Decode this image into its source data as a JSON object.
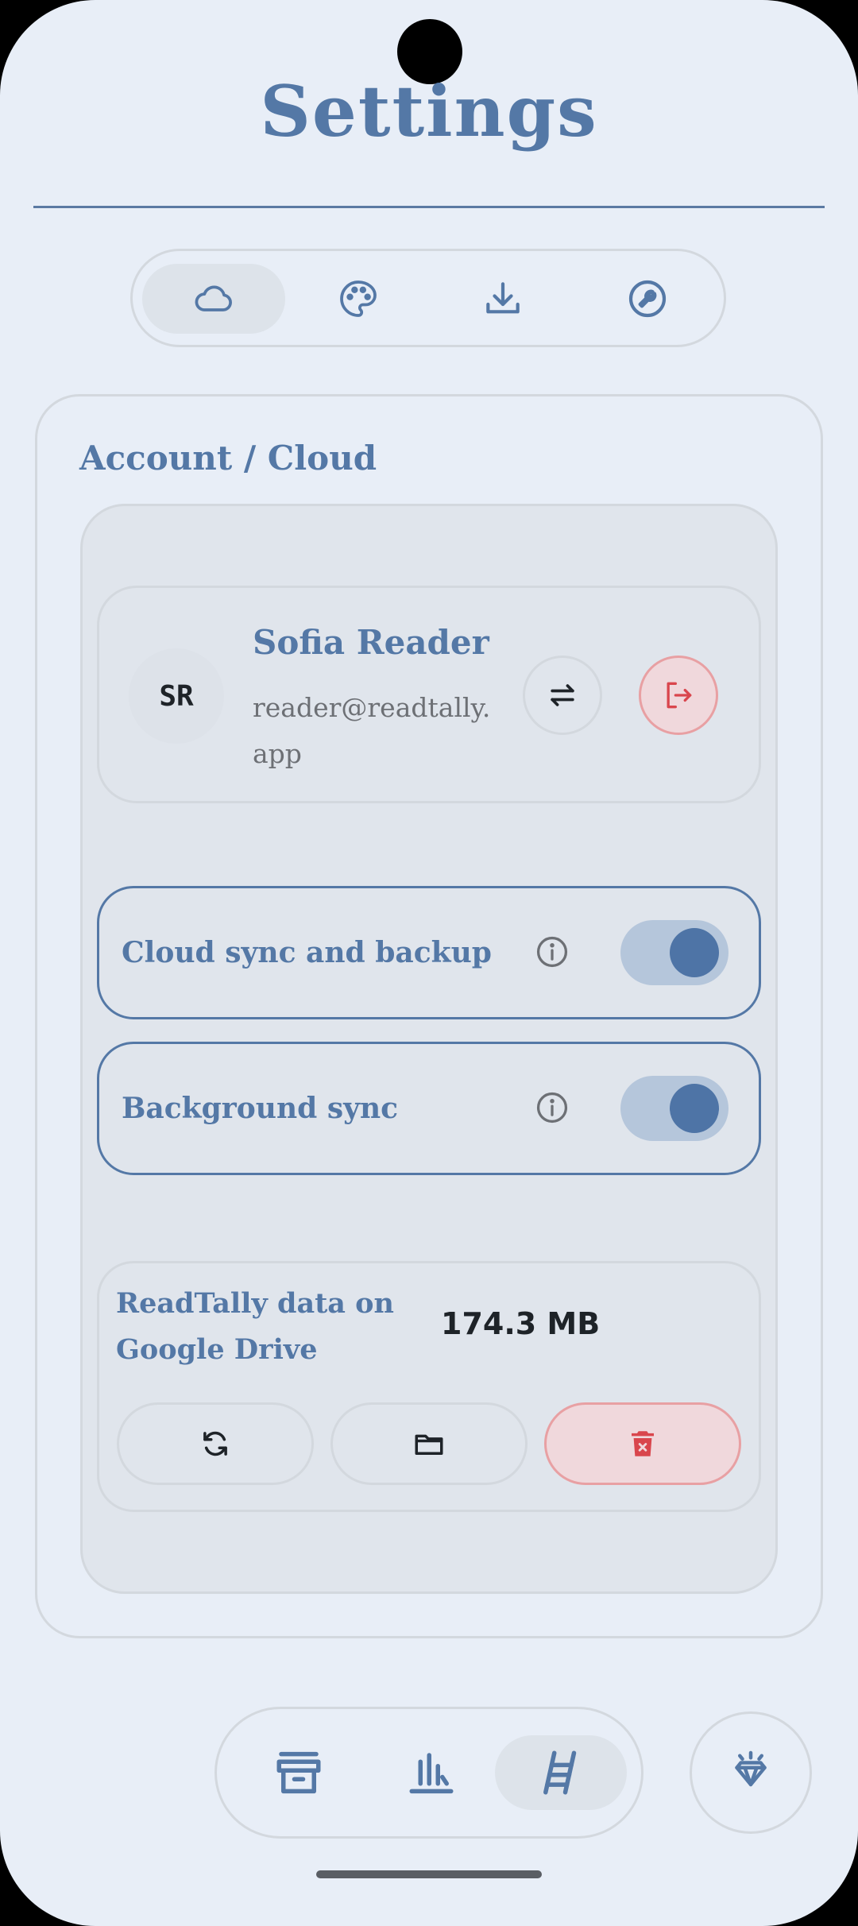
{
  "header": {
    "title": "Settings"
  },
  "tabs": [
    {
      "icon": "cloud-icon",
      "active": true
    },
    {
      "icon": "palette-icon",
      "active": false
    },
    {
      "icon": "download-icon",
      "active": false
    },
    {
      "icon": "wrench-icon",
      "active": false
    }
  ],
  "section": {
    "title": "Account / Cloud"
  },
  "account": {
    "initials": "SR",
    "name": "Sofia Reader",
    "email": "reader@readtally.app"
  },
  "toggles": [
    {
      "label": "Cloud sync and backup",
      "on": true
    },
    {
      "label": "Background sync",
      "on": true
    }
  ],
  "drive": {
    "label": "ReadTally data on Google Drive",
    "size": "174.3 MB"
  },
  "bottom_nav": [
    {
      "icon": "archive-icon",
      "active": false
    },
    {
      "icon": "stats-icon",
      "active": false
    },
    {
      "icon": "ladder-icon",
      "active": true
    }
  ],
  "colors": {
    "accent": "#5478a6",
    "background": "#e8eef7",
    "danger": "#d9464d"
  }
}
